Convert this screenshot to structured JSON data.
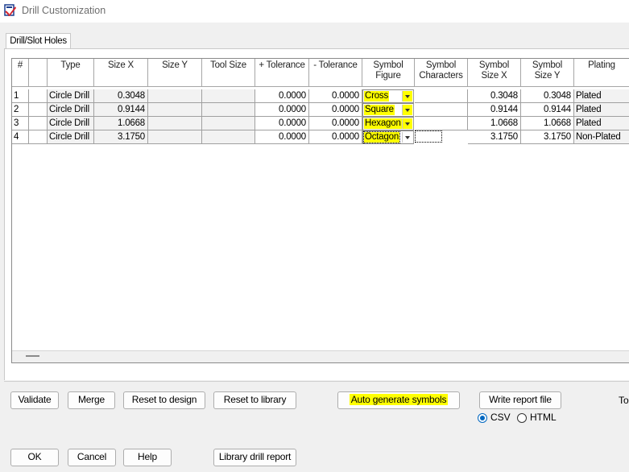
{
  "window": {
    "title": "Drill Customization"
  },
  "tabs": [
    {
      "label": "Drill/Slot Holes"
    }
  ],
  "grid": {
    "columns": [
      {
        "key": "num",
        "label": "#"
      },
      {
        "key": "blank",
        "label": ""
      },
      {
        "key": "type",
        "label": "Type"
      },
      {
        "key": "size_x",
        "label": "Size X"
      },
      {
        "key": "size_y",
        "label": "Size Y"
      },
      {
        "key": "tool_size",
        "label": "Tool Size"
      },
      {
        "key": "plus_tol",
        "label": "+ Tolerance"
      },
      {
        "key": "minus_tol",
        "label": "- Tolerance"
      },
      {
        "key": "sym_fig",
        "label": "Symbol Figure"
      },
      {
        "key": "sym_chars",
        "label": "Symbol Characters"
      },
      {
        "key": "sym_size_x",
        "label": "Symbol Size X"
      },
      {
        "key": "sym_size_y",
        "label": "Symbol Size Y"
      },
      {
        "key": "plating",
        "label": "Plating"
      }
    ],
    "header_lines": {
      "sym_fig": [
        "Symbol",
        "Figure"
      ],
      "sym_chars": [
        "Symbol",
        "Characters"
      ],
      "sym_size_x": [
        "Symbol",
        "Size X"
      ],
      "sym_size_y": [
        "Symbol",
        "Size Y"
      ]
    },
    "rows": [
      {
        "num": "1",
        "type": "Circle Drill",
        "size_x": "0.3048",
        "size_y": "",
        "tool_size": "",
        "plus_tol": "0.0000",
        "minus_tol": "0.0000",
        "sym_fig": "Cross",
        "sym_chars": "",
        "sym_size_x": "0.3048",
        "sym_size_y": "0.3048",
        "plating": "Plated"
      },
      {
        "num": "2",
        "type": "Circle Drill",
        "size_x": "0.9144",
        "size_y": "",
        "tool_size": "",
        "plus_tol": "0.0000",
        "minus_tol": "0.0000",
        "sym_fig": "Square",
        "sym_chars": "",
        "sym_size_x": "0.9144",
        "sym_size_y": "0.9144",
        "plating": "Plated"
      },
      {
        "num": "3",
        "type": "Circle Drill",
        "size_x": "1.0668",
        "size_y": "",
        "tool_size": "",
        "plus_tol": "0.0000",
        "minus_tol": "0.0000",
        "sym_fig": "Hexagon",
        "sym_chars": "",
        "sym_size_x": "1.0668",
        "sym_size_y": "1.0668",
        "plating": "Plated"
      },
      {
        "num": "4",
        "type": "Circle Drill",
        "size_x": "3.1750",
        "size_y": "",
        "tool_size": "",
        "plus_tol": "0.0000",
        "minus_tol": "0.0000",
        "sym_fig": "Octagon",
        "sym_chars": "",
        "sym_size_x": "3.1750",
        "sym_size_y": "3.1750",
        "plating": "Non-Plated"
      }
    ]
  },
  "actions": {
    "validate": "Validate",
    "merge": "Merge",
    "reset_design": "Reset to design",
    "reset_library": "Reset to library",
    "auto_generate": "Auto generate symbols",
    "write_report": "Write report file",
    "cut_label": "To"
  },
  "report_format": {
    "options": [
      {
        "label": "CSV",
        "selected": true
      },
      {
        "label": "HTML",
        "selected": false
      }
    ]
  },
  "footer": {
    "ok": "OK",
    "cancel": "Cancel",
    "help": "Help",
    "library_report": "Library drill report"
  },
  "colors": {
    "highlight": "#ffff00",
    "radio_selected": "#0067c0"
  }
}
